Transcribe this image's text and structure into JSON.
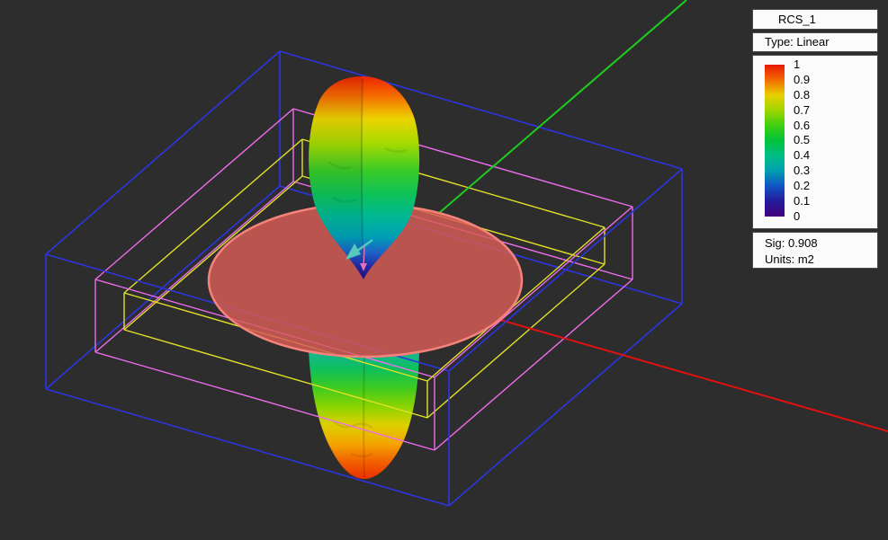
{
  "viewport": {
    "background_color": "#2d2d2d",
    "axes": {
      "green_axis_color": "#1ecb1e",
      "red_axis_color": "#e01111"
    },
    "wireframes": [
      {
        "name": "outer-bounding-box",
        "color": "#2d35df"
      },
      {
        "name": "middle-bounding-box",
        "color": "#ee6cee"
      },
      {
        "name": "inner-bounding-box",
        "color": "#e1e128"
      }
    ],
    "pattern": {
      "disk_fill_color": "#d55c56",
      "disk_edge_color": "#f5837c",
      "lobe_colormap_top_to_bottom": [
        "#ed2400",
        "#f56f00",
        "#ecd400",
        "#a6da00",
        "#3bcb25",
        "#0ec257",
        "#00b894",
        "#009fb6",
        "#1f5ec6",
        "#22269e",
        "#2d0d86"
      ],
      "direction_arrow_color": "#54cabc"
    }
  },
  "legend": {
    "title": "RCS_1",
    "type_label": "Type: Linear",
    "scale_labels": [
      "1",
      "0.9",
      "0.8",
      "0.7",
      "0.6",
      "0.5",
      "0.4",
      "0.3",
      "0.2",
      "0.1",
      "0"
    ],
    "colormap_top_to_bottom": [
      "#e81800",
      "#f36b00",
      "#e8cf00",
      "#9fd600",
      "#3ecf10",
      "#00c33a",
      "#00bd86",
      "#009fb0",
      "#1153c6",
      "#251a99",
      "#43017e"
    ],
    "sig_label": "Sig: 0.908",
    "units_label": "Units: m2"
  }
}
